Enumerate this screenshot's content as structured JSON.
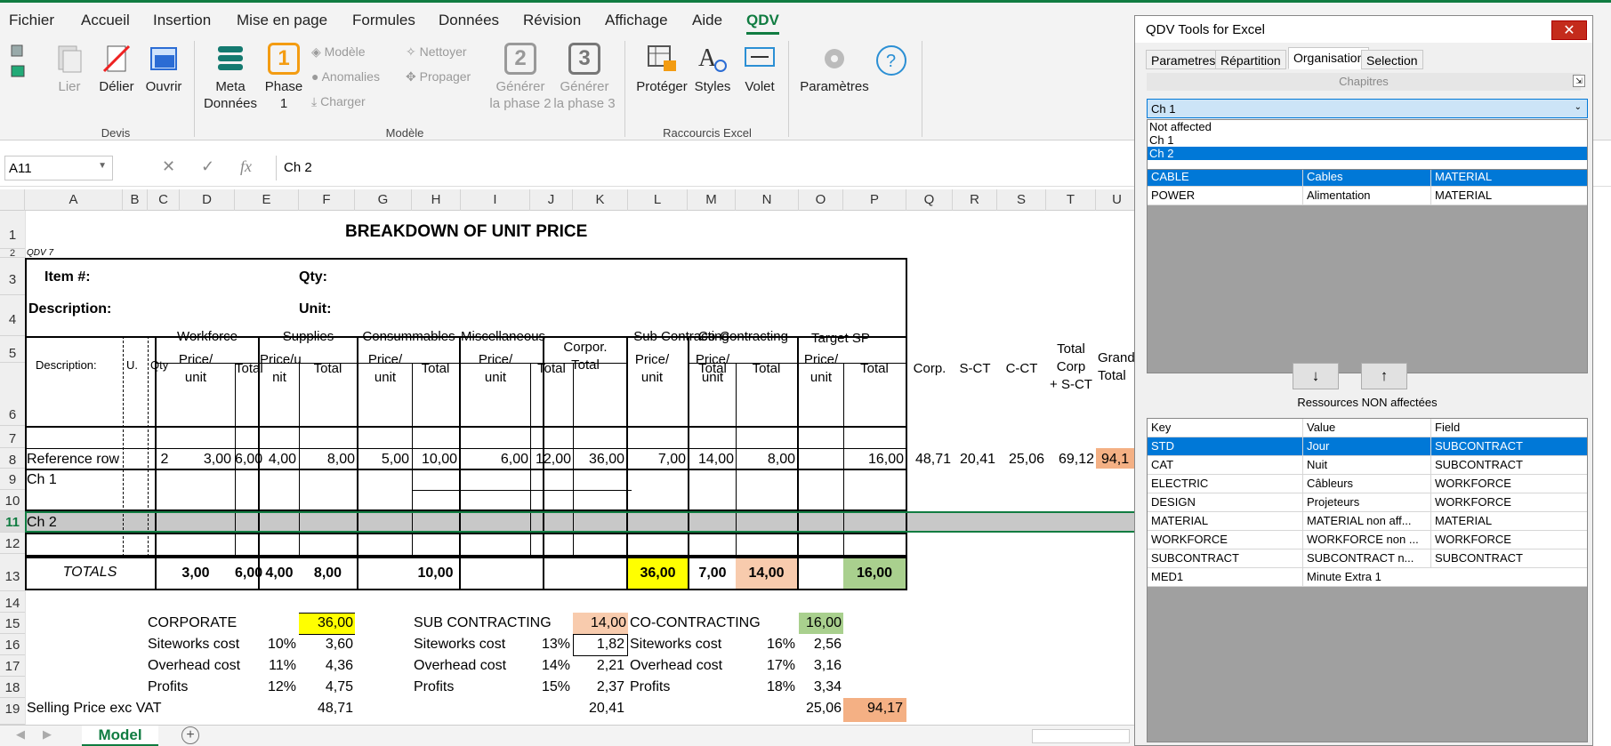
{
  "menu": {
    "tabs": [
      "Fichier",
      "Accueil",
      "Insertion",
      "Mise en page",
      "Formules",
      "Données",
      "Révision",
      "Affichage",
      "Aide",
      "QDV"
    ],
    "active": "QDV"
  },
  "ribbon": {
    "devis": {
      "lier": "Lier",
      "delier": "Délier",
      "ouvrir": "Ouvrir",
      "group": "Devis"
    },
    "modele": {
      "meta": "Meta\nDonnées",
      "phase1": "Phase\n1",
      "phase1_num": "1",
      "modele": "Modèle",
      "anomalies": "Anomalies",
      "charger": "Charger",
      "nettoyer": "Nettoyer",
      "propager": "Propager",
      "gen2": "Générer\nla phase 2",
      "gen2_num": "2",
      "gen3": "Générer\nla phase 3",
      "gen3_num": "3",
      "group": "Modèle"
    },
    "raccourcis": {
      "proteger": "Protéger",
      "styles": "Styles",
      "volet": "Volet",
      "group": "Raccourcis Excel"
    },
    "parametres": "Paramètres"
  },
  "formula": {
    "namebox": "A11",
    "fx": "fx",
    "content": "Ch 2"
  },
  "columns": [
    "A",
    "B",
    "C",
    "D",
    "E",
    "F",
    "G",
    "H",
    "I",
    "J",
    "K",
    "L",
    "M",
    "N",
    "O",
    "P",
    "Q",
    "R",
    "S",
    "T",
    "U"
  ],
  "rows": [
    "1",
    "2",
    "3",
    "4",
    "5",
    "6",
    "7",
    "8",
    "9",
    "10",
    "11",
    "12",
    "13",
    "14",
    "15",
    "16",
    "17",
    "18",
    "19"
  ],
  "sheet": {
    "title": "BREAKDOWN OF UNIT PRICE",
    "qdv": "QDV 7",
    "item": "Item #:",
    "qty": "Qty:",
    "description": "Description:",
    "unit": "Unit:",
    "h_desc": "Description:",
    "h_u": "U.",
    "h_qty": "Qty",
    "h_workforce": "Workforce",
    "h_supplies": "Supplies",
    "h_consumables": "Consummables",
    "h_misc": "Miscellaneous",
    "h_corp": "Corpor.\nTotal",
    "h_sub": "Sub Contracting",
    "h_co": "Co-Contracting",
    "h_target": "Target SP",
    "h_price_unit": "Price/\nunit",
    "h_price_u_nit": "Price/u\nnit",
    "h_total": "Total",
    "h_corp2": "Corp.",
    "h_sct": "S-CT",
    "h_cct": "C-CT",
    "h_totalcorp": "Total\nCorp\n+ S-CT",
    "h_grand": "Grand\nTotal",
    "ref": {
      "label": "Reference row",
      "qty": "2",
      "d": "3,00",
      "e": "6,00",
      "f": "4,00",
      "g": "8,00",
      "h": "5,00",
      "i": "10,00",
      "j": "6,00",
      "k": "12,00",
      "l": "36,00",
      "m": "7,00",
      "n": "14,00",
      "o": "8,00",
      "p": "16,00",
      "q": "48,71",
      "r": "20,41",
      "s": "25,06",
      "t": "69,12",
      "u": "94,1"
    },
    "ch1": "Ch 1",
    "ch2": "Ch 2",
    "totals": {
      "label": "TOTALS",
      "d": "3,00",
      "e": "6,00",
      "f": "4,00",
      "g": "8,00",
      "i": "10,00",
      "l": "36,00",
      "m": "7,00",
      "n": "14,00",
      "p": "16,00"
    },
    "corporate": {
      "label": "CORPORATE",
      "value": "36,00",
      "sw": "Siteworks cost",
      "sw_pct": "10%",
      "sw_val": "3,60",
      "oh": "Overhead cost",
      "oh_pct": "11%",
      "oh_val": "4,36",
      "pr": "Profits",
      "pr_pct": "12%",
      "pr_val": "4,75"
    },
    "subcon": {
      "label": "SUB CONTRACTING",
      "value": "14,00",
      "sw": "Siteworks cost",
      "sw_pct": "13%",
      "sw_val": "1,82",
      "oh": "Overhead cost",
      "oh_pct": "14%",
      "oh_val": "2,21",
      "pr": "Profits",
      "pr_pct": "15%",
      "pr_val": "2,37"
    },
    "cocon": {
      "label": "CO-CONTRACTING",
      "value": "16,00",
      "sw": "Siteworks cost",
      "sw_pct": "16%",
      "sw_val": "2,56",
      "oh": "Overhead cost",
      "oh_pct": "17%",
      "oh_val": "3,16",
      "pr": "Profits",
      "pr_pct": "18%",
      "pr_val": "3,34"
    },
    "selling": {
      "label": "Selling Price  exc VAT",
      "f": "48,71",
      "k": "20,41",
      "o": "25,06",
      "p": "94,17"
    },
    "tab": "Model"
  },
  "colors": {
    "excel_green": "#107c41",
    "yellow": "#ffff00",
    "peach": "#f8cbad",
    "green": "#a9d08e",
    "orange": "#f4b084",
    "selected_row": "#c8c8c8",
    "blue": "#0078d7"
  },
  "panel": {
    "title": "QDV Tools for Excel",
    "close": "✕",
    "tabs": [
      "Parametres",
      "Répartition",
      "Organisation",
      "Selection"
    ],
    "active_tab": "Organisation",
    "chapitres": "Chapitres",
    "selected": "Ch 1",
    "dropdown": [
      "Not affected",
      "Ch 1",
      "Ch 2"
    ],
    "affected": [
      {
        "key": "CABLE",
        "value": "Cables",
        "field": "MATERIAL"
      },
      {
        "key": "POWER",
        "value": "Alimentation",
        "field": "MATERIAL"
      }
    ],
    "down": "↓",
    "up": "↑",
    "non_label": "Ressources NON affectées",
    "headers": {
      "key": "Key",
      "value": "Value",
      "field": "Field"
    },
    "non": [
      {
        "key": "STD",
        "value": "Jour",
        "field": "SUBCONTRACT"
      },
      {
        "key": "CAT",
        "value": "Nuit",
        "field": "SUBCONTRACT"
      },
      {
        "key": "ELECTRIC",
        "value": "Câbleurs",
        "field": "WORKFORCE"
      },
      {
        "key": "DESIGN",
        "value": "Projeteurs",
        "field": "WORKFORCE"
      },
      {
        "key": "MATERIAL",
        "value": "MATERIAL non aff...",
        "field": "MATERIAL"
      },
      {
        "key": "WORKFORCE",
        "value": "WORKFORCE non ...",
        "field": "WORKFORCE"
      },
      {
        "key": "SUBCONTRACT",
        "value": "SUBCONTRACT n...",
        "field": "SUBCONTRACT"
      },
      {
        "key": "MED1",
        "value": "Minute Extra 1",
        "field": ""
      }
    ]
  }
}
